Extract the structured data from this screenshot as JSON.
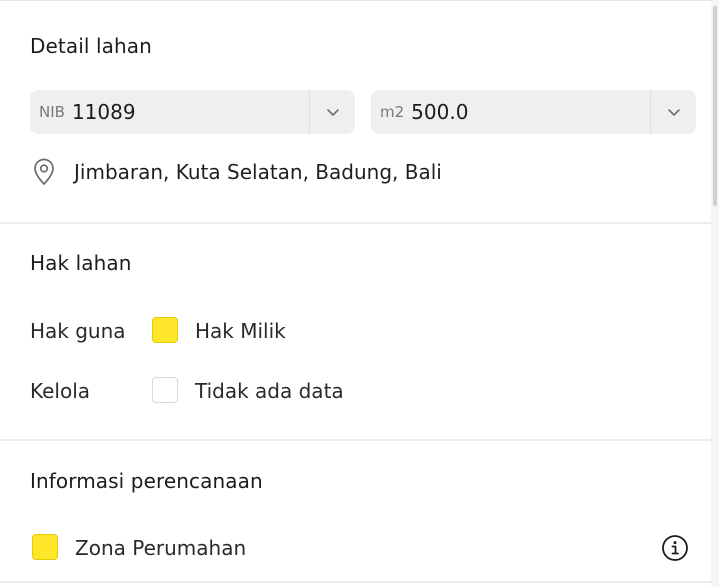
{
  "detail": {
    "title": "Detail lahan",
    "nib": {
      "prefix": "NIB",
      "value": "11089"
    },
    "area": {
      "prefix": "m2",
      "value": "500.0"
    },
    "location": "Jimbaran, Kuta Selatan, Badung, Bali"
  },
  "hak": {
    "title": "Hak lahan",
    "rows": [
      {
        "label": "Hak guna",
        "value": "Hak Milik",
        "color": "#ffe62b"
      },
      {
        "label": "Kelola",
        "value": "Tidak ada data",
        "color": "#ffffff"
      }
    ]
  },
  "perencanaan": {
    "title": "Informasi perencanaan",
    "zone": {
      "label": "Zona Perumahan",
      "color": "#ffe62b"
    }
  },
  "icons": {
    "dropdown": "chevron-down-icon",
    "location": "map-pin-icon",
    "info": "info-circle-icon"
  }
}
